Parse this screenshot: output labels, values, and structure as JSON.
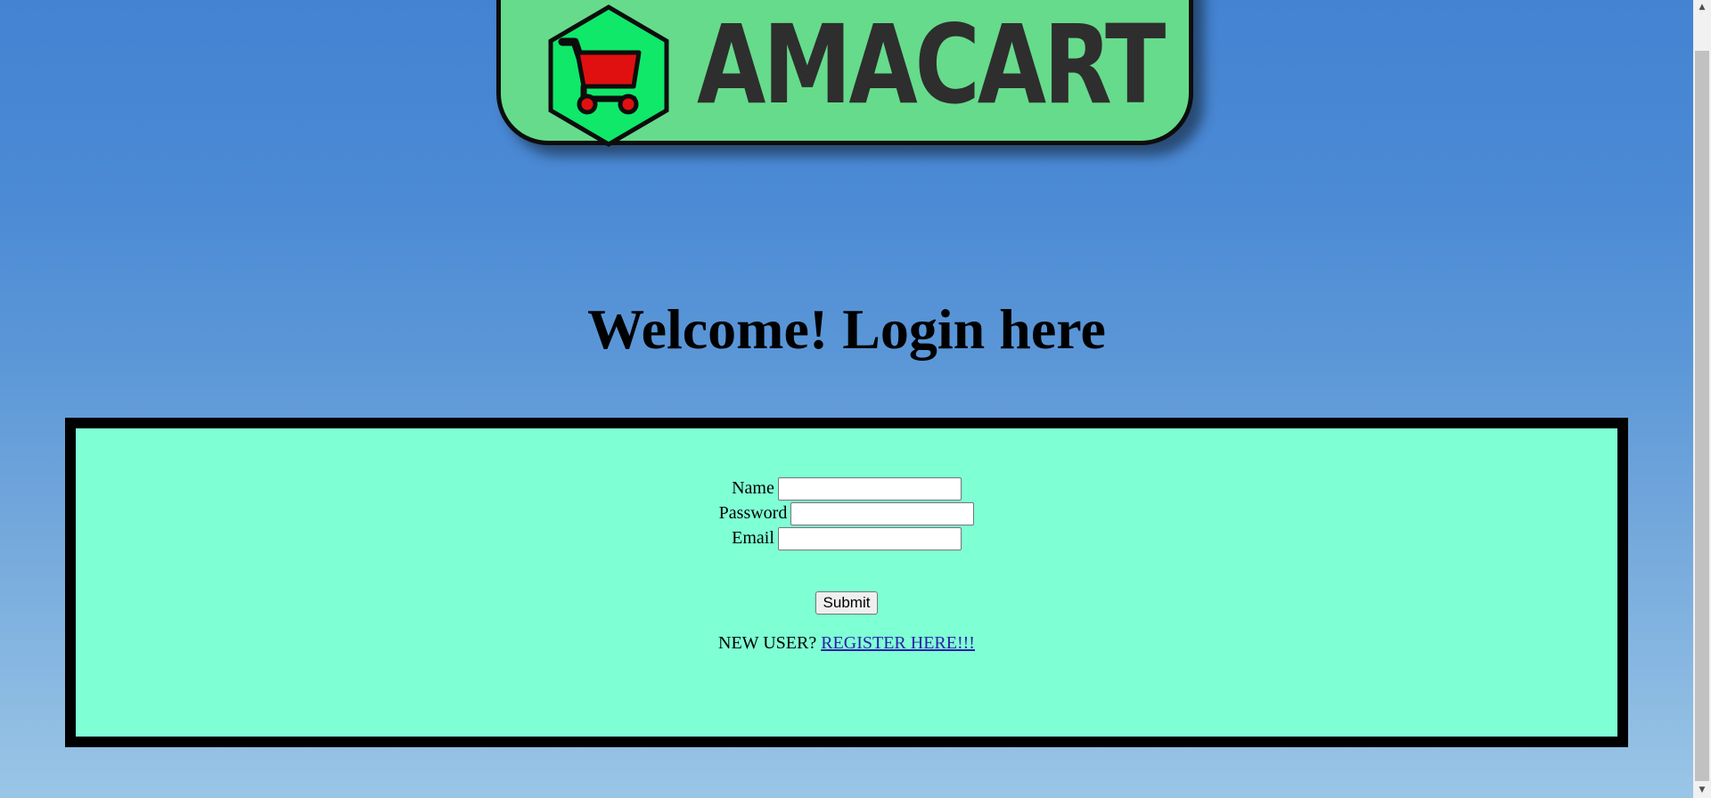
{
  "logo": {
    "text": "AMACART",
    "icon": "cart-icon",
    "colors": {
      "banner": "#66db8b",
      "hexagon": "#10e86a",
      "cart": "#e01010",
      "text": "#2e2e2e"
    }
  },
  "heading": "Welcome! Login here",
  "form": {
    "name_label": "Name",
    "name_value": "",
    "password_label": "Password",
    "password_value": "",
    "email_label": "Email",
    "email_value": "",
    "submit_label": "Submit",
    "new_user_text": "NEW USER?",
    "register_link": "REGISTER HERE!!!"
  },
  "colors": {
    "panel_background": "#7fffd4",
    "panel_border": "#000000",
    "link": "#2b1fa8"
  },
  "scrollbar": {
    "up_icon": "arrow-up-icon",
    "down_icon": "arrow-down-icon"
  }
}
